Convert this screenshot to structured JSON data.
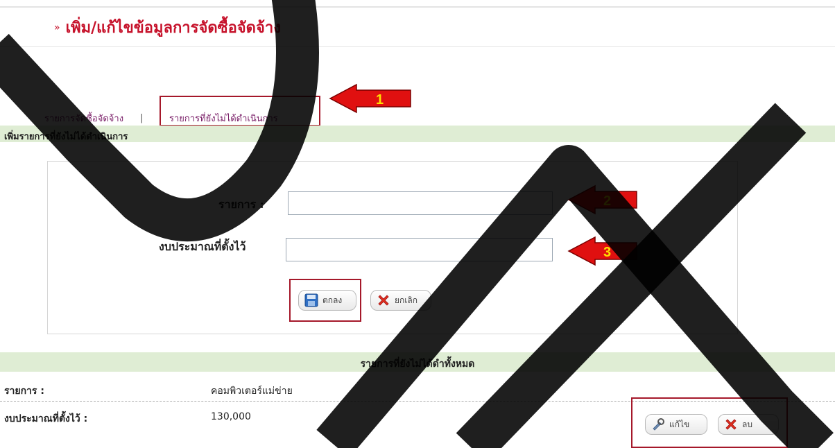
{
  "header": {
    "title": "เพิ่ม/แก้ไขข้อมูลการจัดซื้อจัดจ้าง",
    "bullet": "»"
  },
  "tabs": {
    "items": [
      "รายการจัดซื้อจัดจ้าง",
      "รายการที่ยังไม่ได้ดำเนินการ"
    ],
    "separator": "|"
  },
  "section_add": {
    "title": "เพิ่มรายการที่ยังไม่ได้ดำเนินการ"
  },
  "form": {
    "item_label": "รายการ :",
    "item_value": "",
    "budget_label": "งบประมาณที่ตั้งไว้",
    "budget_value": "",
    "ok_label": "ตกลง",
    "cancel_label": "ยกเลิก"
  },
  "callouts": [
    "1",
    "2",
    "3"
  ],
  "list": {
    "title": "รายการที่ยังไม่ได้ดำทั้งหมด",
    "item_label": "รายการ :",
    "item_value": "คอมพิวเตอร์แม่ข่าย",
    "budget_label": "งบประมาณที่ตั้งไว้ :",
    "budget_value": "130,000",
    "edit_label": "แก้ไข",
    "delete_label": "ลบ"
  },
  "colors": {
    "title_red": "#c6112a",
    "highlight_box": "#a5182a",
    "section_bar": "#dfedd4",
    "arrow_red": "#e01010",
    "arrow_text": "#ffe000"
  },
  "icons": {
    "save": "floppy-disk-icon",
    "cancel": "red-x-icon",
    "edit": "tools-icon",
    "delete": "red-x-icon",
    "callout": "left-arrow-icon"
  }
}
